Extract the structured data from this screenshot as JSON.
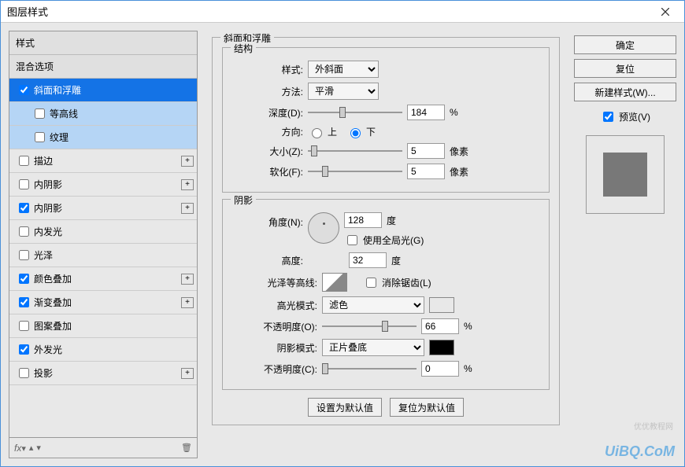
{
  "window": {
    "title": "图层样式"
  },
  "left": {
    "header1": "样式",
    "header2": "混合选项",
    "items": [
      {
        "label": "斜面和浮雕",
        "checked": true,
        "selected": true,
        "hasAdd": false
      },
      {
        "label": "等高线",
        "checked": false,
        "sub": true
      },
      {
        "label": "纹理",
        "checked": false,
        "sub": true
      },
      {
        "label": "描边",
        "checked": false,
        "hasAdd": true
      },
      {
        "label": "内阴影",
        "checked": false,
        "hasAdd": true
      },
      {
        "label": "内阴影",
        "checked": true,
        "hasAdd": true
      },
      {
        "label": "内发光",
        "checked": false
      },
      {
        "label": "光泽",
        "checked": false
      },
      {
        "label": "颜色叠加",
        "checked": true,
        "hasAdd": true
      },
      {
        "label": "渐变叠加",
        "checked": true,
        "hasAdd": true
      },
      {
        "label": "图案叠加",
        "checked": false
      },
      {
        "label": "外发光",
        "checked": true
      },
      {
        "label": "投影",
        "checked": false,
        "hasAdd": true
      }
    ],
    "footer_fx": "fx"
  },
  "center": {
    "group1_title": "斜面和浮雕",
    "structure": {
      "title": "结构",
      "style_label": "样式:",
      "style_value": "外斜面",
      "method_label": "方法:",
      "method_value": "平滑",
      "depth_label": "深度(D):",
      "depth_value": "184",
      "depth_unit": "%",
      "direction_label": "方向:",
      "dir_up": "上",
      "dir_down": "下",
      "size_label": "大小(Z):",
      "size_value": "5",
      "size_unit": "像素",
      "soften_label": "软化(F):",
      "soften_value": "5",
      "soften_unit": "像素"
    },
    "shading": {
      "title": "阴影",
      "angle_label": "角度(N):",
      "angle_value": "128",
      "angle_unit": "度",
      "global_light": "使用全局光(G)",
      "altitude_label": "高度:",
      "altitude_value": "32",
      "altitude_unit": "度",
      "gloss_label": "光泽等高线:",
      "antialias": "消除锯齿(L)",
      "highlight_mode_label": "高光模式:",
      "highlight_mode_value": "滤色",
      "highlight_color": "#ffffff",
      "opacity1_label": "不透明度(O):",
      "opacity1_value": "66",
      "opacity1_unit": "%",
      "shadow_mode_label": "阴影模式:",
      "shadow_mode_value": "正片叠底",
      "shadow_color": "#000000",
      "opacity2_label": "不透明度(C):",
      "opacity2_value": "0",
      "opacity2_unit": "%"
    },
    "btn_default": "设置为默认值",
    "btn_reset": "复位为默认值"
  },
  "right": {
    "ok": "确定",
    "reset": "复位",
    "new_style": "新建样式(W)...",
    "preview": "预览(V)"
  },
  "watermark": "UiBQ.CoM",
  "watermark2": "优优教程网"
}
